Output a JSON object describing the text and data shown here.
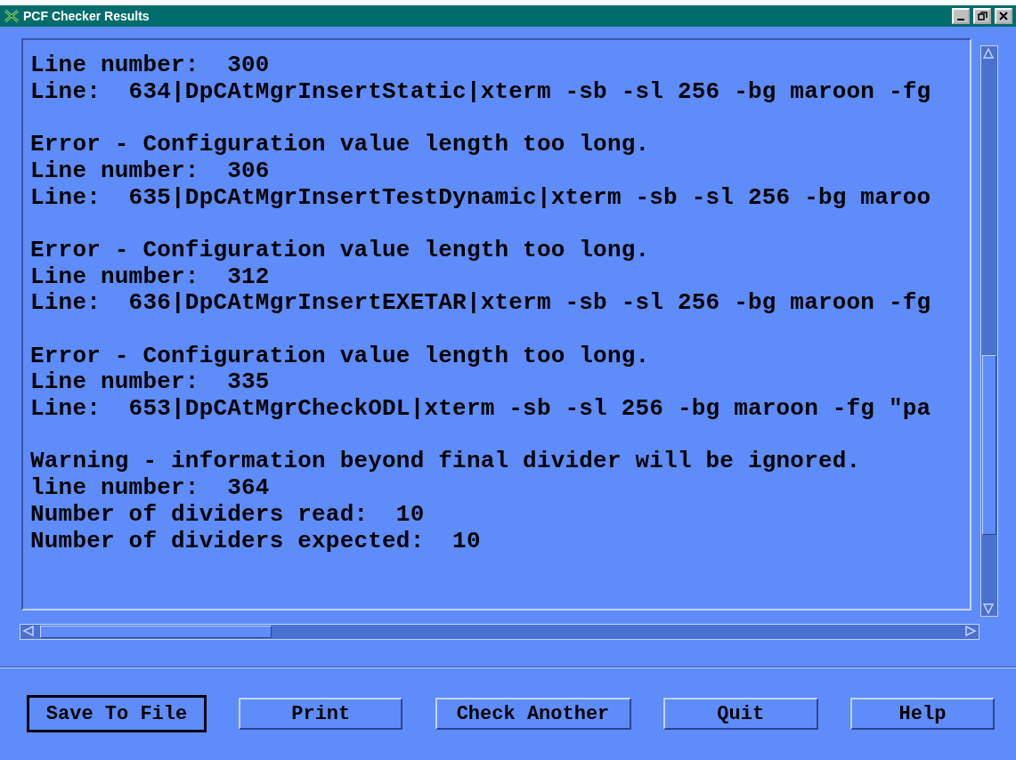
{
  "window": {
    "title": "PCF Checker Results"
  },
  "output_blocks": [
    [
      "Line number:  300",
      "Line:  634|DpCAtMgrInsertStatic|xterm -sb -sl 256 -bg maroon -fg"
    ],
    [
      "Error - Configuration value length too long.",
      "Line number:  306",
      "Line:  635|DpCAtMgrInsertTestDynamic|xterm -sb -sl 256 -bg maroo"
    ],
    [
      "Error - Configuration value length too long.",
      "Line number:  312",
      "Line:  636|DpCAtMgrInsertEXETAR|xterm -sb -sl 256 -bg maroon -fg"
    ],
    [
      "Error - Configuration value length too long.",
      "Line number:  335",
      "Line:  653|DpCAtMgrCheckODL|xterm -sb -sl 256 -bg maroon -fg \"pa"
    ],
    [
      "Warning - information beyond final divider will be ignored.",
      "line number:  364",
      "Number of dividers read:  10",
      "Number of dividers expected:  10"
    ]
  ],
  "buttons": [
    {
      "label": "Save To File",
      "default": true
    },
    {
      "label": "Print",
      "default": false
    },
    {
      "label": "Check Another",
      "default": false
    },
    {
      "label": "Quit",
      "default": false
    },
    {
      "label": "Help",
      "default": false
    }
  ]
}
